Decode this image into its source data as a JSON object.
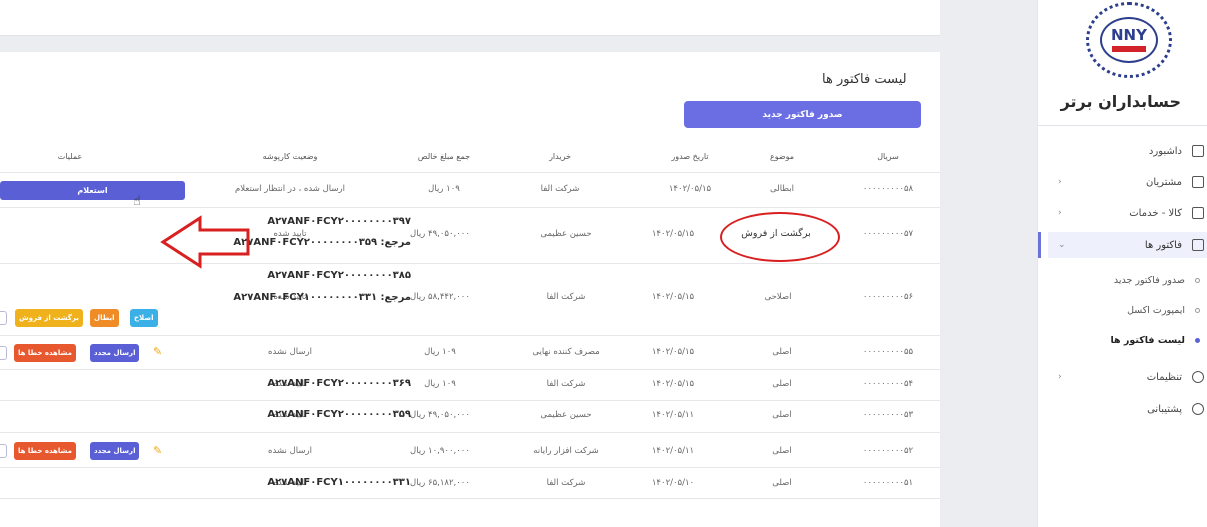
{
  "sidebar": {
    "logo_text": "NNY",
    "brand": "حسابداران برتر",
    "nav": [
      {
        "label": "داشبورد",
        "icon": "home-icon"
      },
      {
        "label": "مشتریان",
        "icon": "users-icon"
      },
      {
        "label": "کالا - خدمات",
        "icon": "box-icon"
      },
      {
        "label": "فاکتور ها",
        "icon": "invoice-icon"
      },
      {
        "label": "تنظیمات",
        "icon": "gear-icon"
      },
      {
        "label": "پشتیبانی",
        "icon": "support-icon"
      }
    ],
    "sub": [
      {
        "label": "صدور فاکتور جدید"
      },
      {
        "label": "ایمپورت اکسل"
      },
      {
        "label": "لیست فاکتور ها"
      }
    ]
  },
  "page": {
    "title": "لیست فاکتور ها",
    "new_invoice_button": "صدور فاکتور جدید"
  },
  "table": {
    "headers": {
      "serial": "سریال",
      "topic": "موضوع",
      "issue_date": "تاریخ صدور",
      "buyer": "خریدار",
      "net_total": "جمع مبلغ خالص",
      "status": "وضعیت کارپوشه",
      "ops": "عملیات"
    },
    "rows": [
      {
        "serial": "۰۰۰۰۰۰۰۰۰۵۸",
        "topic": "ابطالی",
        "date": "۱۴۰۲/۰۵/۱۵",
        "buyer": "شرکت الفا",
        "total": "۱۰۹ ریال",
        "status": "ارسال شده ، در انتظار استعلام"
      },
      {
        "serial": "۰۰۰۰۰۰۰۰۰۵۷",
        "topic": "برگشت از فروش",
        "date": "۱۴۰۲/۰۵/۱۵",
        "buyer": "حسین عظیمی",
        "total": "۴۹,۰۵۰,۰۰۰ ریال",
        "status": "تایید شده",
        "ref_main": "A۲۷ANF۰FCY۲۰۰۰۰۰۰۰۰۳۹۷",
        "ref_label": "مرجع:",
        "ref_value": "A۲۷ANF۰FCY۲۰۰۰۰۰۰۰۰۳۵۹"
      },
      {
        "serial": "۰۰۰۰۰۰۰۰۰۵۶",
        "topic": "اصلاحی",
        "date": "۱۴۰۲/۰۵/۱۵",
        "buyer": "شرکت الفا",
        "total": "۵۸,۴۴۲,۰۰۰ ریال",
        "status": "تایید شده",
        "ref_main": "A۲۷ANF۰FCY۲۰۰۰۰۰۰۰۰۳۸۵",
        "ref_label": "مرجع:",
        "ref_value": "A۲۷ANF۰FCY۱۰۰۰۰۰۰۰۰۳۳۱"
      },
      {
        "serial": "۰۰۰۰۰۰۰۰۰۵۵",
        "topic": "اصلی",
        "date": "۱۴۰۲/۰۵/۱۵",
        "buyer": "مصرف کننده نهایی",
        "total": "۱۰۹ ریال",
        "status": "ارسال نشده"
      },
      {
        "serial": "۰۰۰۰۰۰۰۰۰۵۴",
        "topic": "اصلی",
        "date": "۱۴۰۲/۰۵/۱۵",
        "buyer": "شرکت الفا",
        "total": "۱۰۹ ریال",
        "status": "تایید شده",
        "ref_main": "A۲۷ANF۰FCY۲۰۰۰۰۰۰۰۰۳۶۹"
      },
      {
        "serial": "۰۰۰۰۰۰۰۰۰۵۳",
        "topic": "اصلی",
        "date": "۱۴۰۲/۰۵/۱۱",
        "buyer": "حسین عظیمی",
        "total": "۴۹,۰۵۰,۰۰۰ ریال",
        "status": "تایید شده",
        "ref_main": "A۲۷ANF۰FCY۲۰۰۰۰۰۰۰۰۳۵۹"
      },
      {
        "serial": "۰۰۰۰۰۰۰۰۰۵۲",
        "topic": "اصلی",
        "date": "۱۴۰۲/۰۵/۱۱",
        "buyer": "شرکت افزار رایانه",
        "total": "۱۰,۹۰۰,۰۰۰ ریال",
        "status": "ارسال نشده"
      },
      {
        "serial": "۰۰۰۰۰۰۰۰۰۵۱",
        "topic": "اصلی",
        "date": "۱۴۰۲/۰۵/۱۰",
        "buyer": "شرکت الفا",
        "total": "۶۵,۱۸۲,۰۰۰ ریال",
        "status": "تایید شده",
        "ref_main": "A۲۷ANF۰FCY۱۰۰۰۰۰۰۰۰۳۳۱"
      }
    ],
    "buttons": {
      "inquiry": "استعلام",
      "fix": "اصلاح",
      "cancel": "ابطال",
      "return": "برگشت از فروش",
      "view_errors": "مشاهده خطا ها",
      "resend": "ارسال مجدد"
    }
  }
}
